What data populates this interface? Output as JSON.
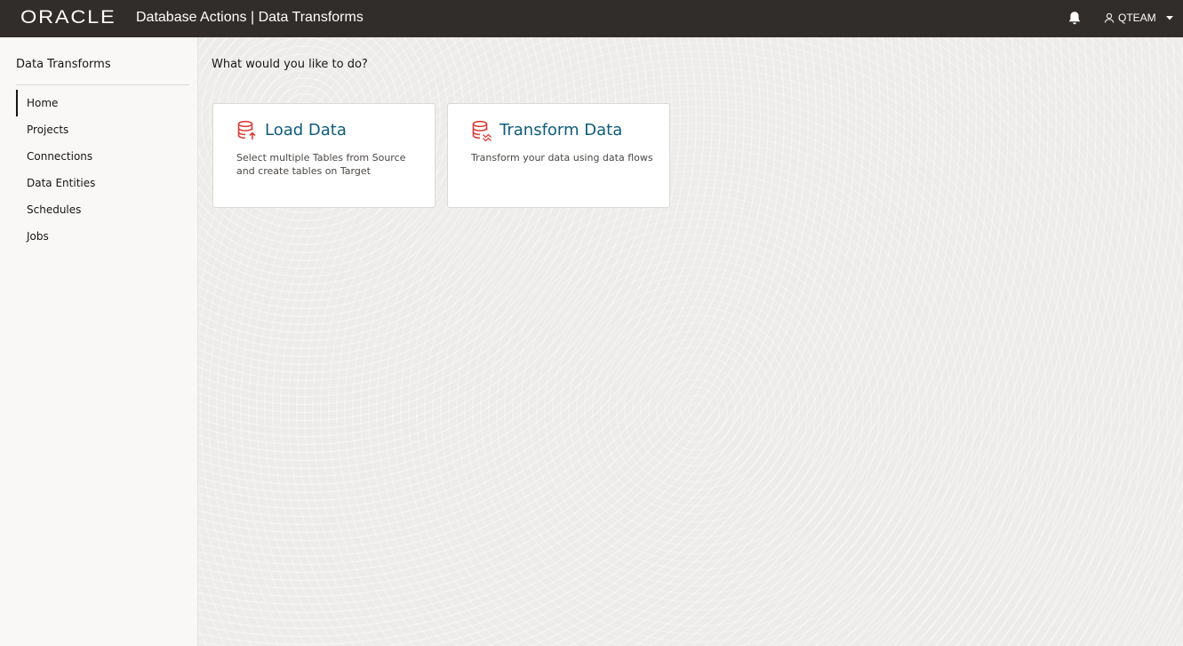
{
  "header": {
    "brand": "ORACLE",
    "app_title": "Database Actions | Data Transforms",
    "user_name": "QTEAM",
    "icons": {
      "notifications": "bell-icon",
      "user": "user-icon",
      "menu": "caret-down-icon"
    },
    "colors": {
      "background": "#312d2a",
      "text": "#ffffff"
    }
  },
  "sidebar": {
    "title": "Data Transforms",
    "items": [
      {
        "label": "Home",
        "active": true
      },
      {
        "label": "Projects",
        "active": false
      },
      {
        "label": "Connections",
        "active": false
      },
      {
        "label": "Data Entities",
        "active": false
      },
      {
        "label": "Schedules",
        "active": false
      },
      {
        "label": "Jobs",
        "active": false
      }
    ]
  },
  "main": {
    "prompt": "What would you like to do?",
    "cards": [
      {
        "title": "Load Data",
        "description": "Select multiple Tables from Source and create tables on Target",
        "icon": "database-load-icon"
      },
      {
        "title": "Transform Data",
        "description": "Transform your data using data flows",
        "icon": "database-transform-icon"
      }
    ],
    "colors": {
      "card_title": "#0f5c7c",
      "card_icon": "#d9403a"
    }
  }
}
